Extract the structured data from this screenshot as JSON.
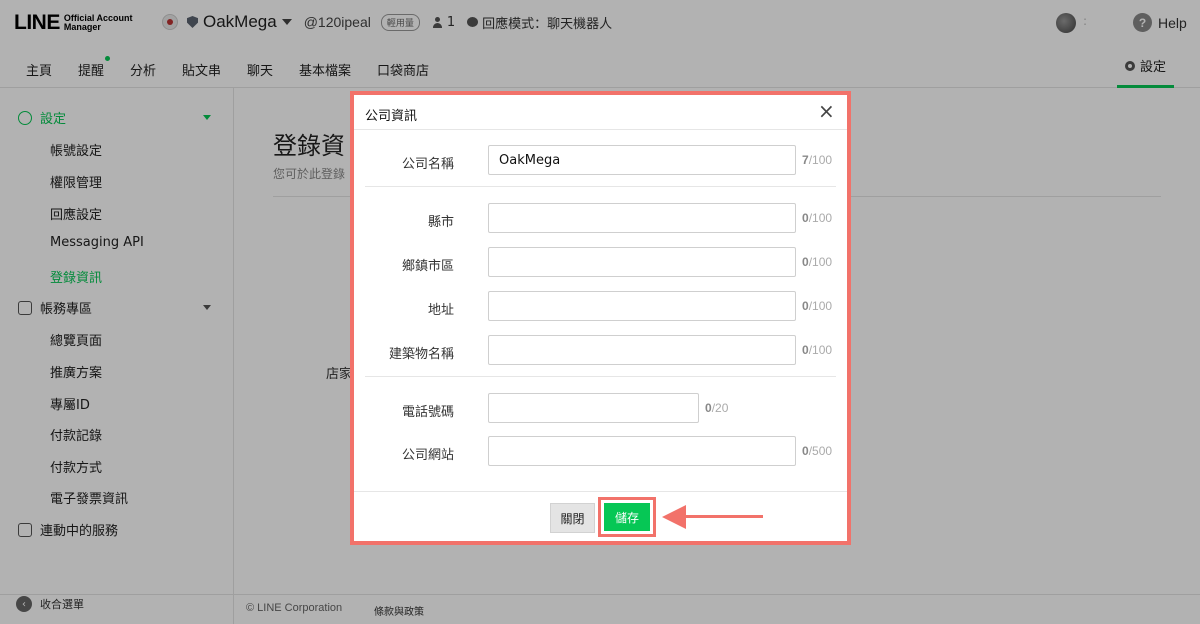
{
  "header": {
    "logo_line": "LINE",
    "logo_sub1": "Official Account",
    "logo_sub2": "Manager",
    "account_name": "OakMega",
    "account_id": "@120ipeal",
    "plan_badge": "輕用量",
    "friend_count": "1",
    "response_mode": "回應模式：聊天機器人",
    "help_label": "Help",
    "help_icon_text": "?",
    "more_icon_text": ":"
  },
  "nav": {
    "items": [
      "主頁",
      "提醒",
      "分析",
      "貼文串",
      "聊天",
      "基本檔案",
      "口袋商店"
    ],
    "settings_label": "設定"
  },
  "sidebar": {
    "group_settings": "設定",
    "settings_items": [
      "帳號設定",
      "權限管理",
      "回應設定",
      "Messaging API",
      "登錄資訊"
    ],
    "group_account": "帳務專區",
    "account_items": [
      "總覽頁面",
      "推廣方案",
      "專屬ID",
      "付款記錄",
      "付款方式",
      "電子發票資訊"
    ],
    "group_linked": "連動中的服務",
    "collapse_label": "收合選單",
    "collapse_icon_text": "‹"
  },
  "main": {
    "title": "登錄資",
    "subtitle": "您可於此登錄",
    "store_label": "店家",
    "copyright": "© LINE Corporation",
    "terms": "條款與政策"
  },
  "modal": {
    "title": "公司資訊",
    "close_glyph": "×",
    "fields": [
      {
        "label": "公司名稱",
        "value": "OakMega",
        "count": "7",
        "max": "/100"
      },
      {
        "label": "縣市",
        "value": "",
        "count": "0",
        "max": "/100"
      },
      {
        "label": "鄉鎮市區",
        "value": "",
        "count": "0",
        "max": "/100"
      },
      {
        "label": "地址",
        "value": "",
        "count": "0",
        "max": "/100"
      },
      {
        "label": "建築物名稱",
        "value": "",
        "count": "0",
        "max": "/100"
      },
      {
        "label": "電話號碼",
        "value": "",
        "count": "0",
        "max": "/20"
      },
      {
        "label": "公司網站",
        "value": "",
        "count": "0",
        "max": "/500"
      }
    ],
    "close_button": "關閉",
    "save_button": "儲存"
  },
  "colors": {
    "brand_green": "#06c755",
    "highlight_red": "#f2726a",
    "overlay": "rgba(0,0,0,0.30)"
  }
}
